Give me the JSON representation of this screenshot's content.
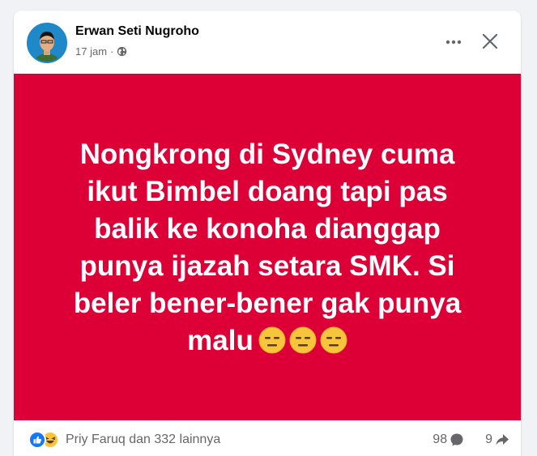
{
  "post": {
    "author": "Erwan Seti Nugroho",
    "time": "17 jam",
    "separator": "·",
    "visibility_icon": "globe-icon",
    "body_text": "Nongkrong di Sydney cuma ikut Bimbel doang tapi pas balik ke konoha dianggap punya ijazah setara SMK. Si beler bener-bener gak punya malu",
    "emoji_icons": [
      "expressionless-face-icon",
      "expressionless-face-icon",
      "expressionless-face-icon"
    ],
    "background_color": "#dc0036"
  },
  "footer": {
    "reaction_icons": [
      "like-icon",
      "haha-icon"
    ],
    "reaction_summary": "Priy Faruq dan 332 lainnya",
    "comment_count": "98",
    "share_count": "9"
  },
  "colors": {
    "page_bg": "#f0f2f5",
    "card_bg": "#ffffff",
    "meta_text": "#65676b",
    "like_blue": "#1877f2",
    "emoji_yellow": "#f7c53b"
  }
}
